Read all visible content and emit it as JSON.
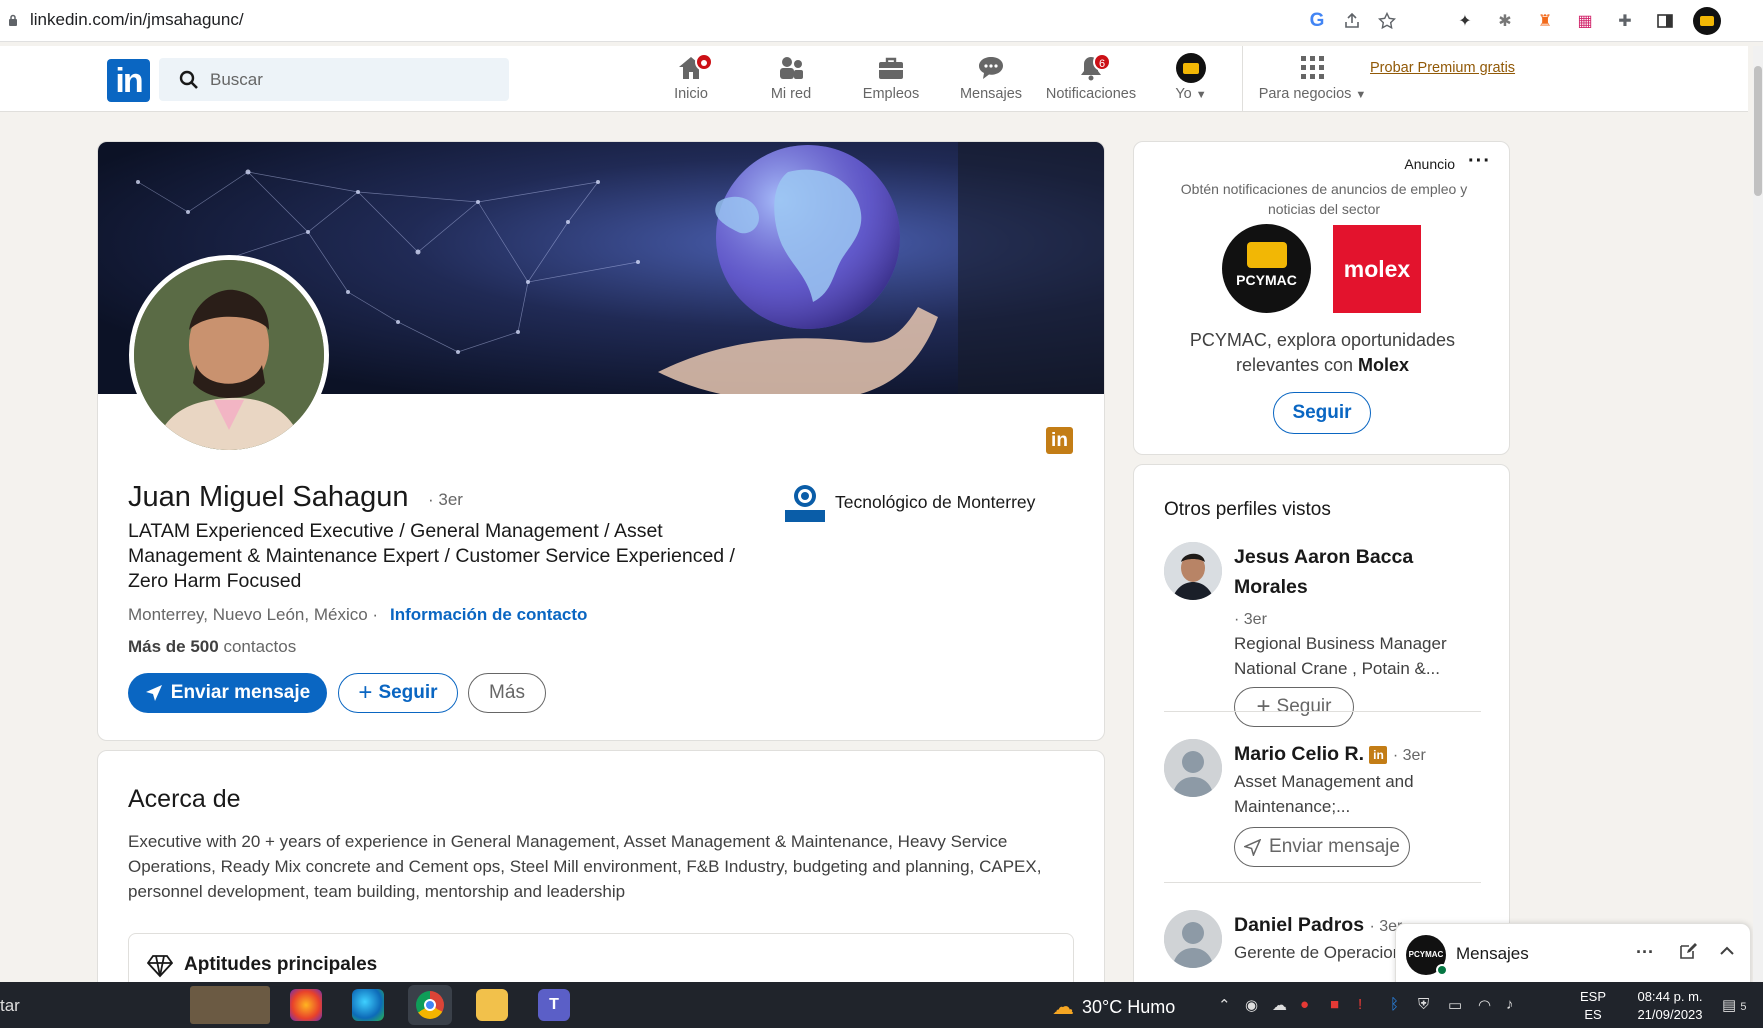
{
  "browser": {
    "url": "linkedin.com/in/jmsahagunc/"
  },
  "nav": {
    "logo": "in",
    "search_placeholder": "Buscar",
    "items": [
      {
        "label": "Inicio",
        "badge": ""
      },
      {
        "label": "Mi red",
        "badge": ""
      },
      {
        "label": "Empleos",
        "badge": ""
      },
      {
        "label": "Mensajes",
        "badge": ""
      },
      {
        "label": "Notificaciones",
        "badge": "6"
      },
      {
        "label": "Yo",
        "badge": ""
      },
      {
        "label": "Para negocios",
        "badge": ""
      }
    ],
    "premium": "Probar Premium gratis"
  },
  "profile": {
    "name": "Juan Miguel Sahagun",
    "degree": "· 3er",
    "headline": "LATAM Experienced Executive / General Management / Asset Management & Maintenance Expert / Customer Service Experienced / Zero Harm Focused",
    "location": "Monterrey, Nuevo León, México ·",
    "contact_link": "Información de contacto",
    "connections_bold": "Más de 500",
    "connections_rest": " contactos",
    "education": "Tecnológico de Monterrey",
    "buttons": {
      "message": "Enviar mensaje",
      "follow": "Seguir",
      "more": "Más"
    }
  },
  "about": {
    "title": "Acerca de",
    "text": "Executive with 20 + years of experience in General Management, Asset Management & Maintenance, Heavy Service Operations, Ready Mix concrete and Cement ops, Steel Mill environment, F&B Industry, budgeting and planning, CAPEX, personnel development, team building, mentorship and leadership",
    "skills_title": "Aptitudes principales"
  },
  "ad": {
    "label": "Anuncio",
    "subtitle": "Obtén notificaciones de anuncios de empleo y noticias del sector",
    "logo1": "PCYMAC",
    "logo2": "molex",
    "text_pre": "PCYMAC, explora oportunidades relevantes con ",
    "text_bold": "Molex",
    "button": "Seguir"
  },
  "others": {
    "title": "Otros perfiles vistos",
    "people": [
      {
        "name": "Jesus Aaron Bacca Morales",
        "degree": "· 3er",
        "desc": "Regional Business Manager National Crane , Potain &...",
        "button": "Seguir"
      },
      {
        "name": "Mario Celio R.",
        "degree": "· 3er",
        "desc": "Asset Management and Maintenance;...",
        "button": "Enviar mensaje"
      },
      {
        "name": "Daniel Padros",
        "degree": "· 3er",
        "desc": "Gerente de Operaciones"
      }
    ]
  },
  "messaging": {
    "label": "Mensajes",
    "avatar_text": "PCYMAC"
  },
  "taskbar": {
    "left_text": "tar",
    "weather": "30°C  Humo",
    "lang1": "ESP",
    "lang2": "ES",
    "time": "08:44 p. m.",
    "date": "21/09/2023",
    "notif_count": "5"
  },
  "colors": {
    "brand": "#0a66c2",
    "premium": "#915907",
    "badge": "#cc1016"
  }
}
